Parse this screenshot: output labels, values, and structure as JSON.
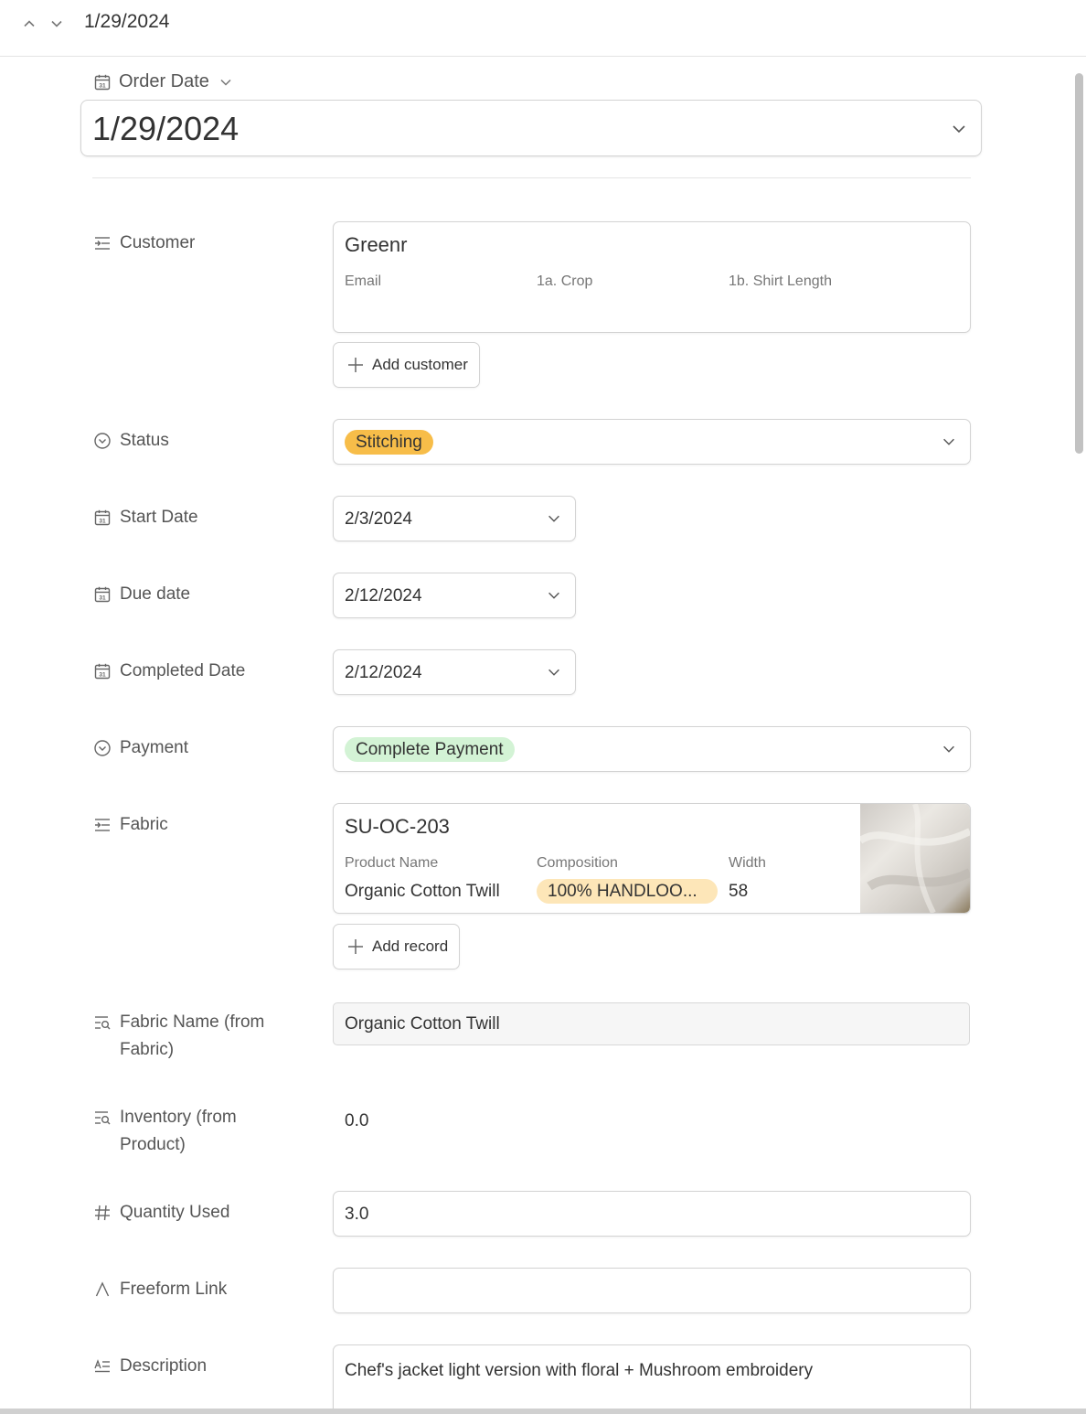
{
  "header": {
    "title": "1/29/2024",
    "prev_icon": "chevron-up-icon",
    "next_icon": "chevron-down-icon"
  },
  "primary_field": {
    "label": "Order Date",
    "value": "1/29/2024",
    "icon": "calendar-icon"
  },
  "customer": {
    "label": "Customer",
    "icon": "link-record-icon",
    "record": {
      "title": "Greenr",
      "columns": [
        "Email",
        "1a. Crop",
        "1b. Shirt Length"
      ]
    },
    "add_label": "Add customer"
  },
  "status": {
    "label": "Status",
    "icon": "single-select-icon",
    "value": "Stitching",
    "color": "#f7bd49"
  },
  "start_date": {
    "label": "Start Date",
    "icon": "calendar-icon",
    "value": "2/3/2024"
  },
  "due_date": {
    "label": "Due date",
    "icon": "calendar-icon",
    "value": "2/12/2024"
  },
  "completed_date": {
    "label": "Completed Date",
    "icon": "calendar-icon",
    "value": "2/12/2024"
  },
  "payment": {
    "label": "Payment",
    "icon": "single-select-icon",
    "value": "Complete Payment",
    "color": "#d3f3d5"
  },
  "fabric": {
    "label": "Fabric",
    "icon": "link-record-icon",
    "record": {
      "title": "SU-OC-203",
      "columns": [
        "Product Name",
        "Composition",
        "Width"
      ],
      "values": [
        "Organic Cotton Twill",
        "100% HANDLOO...",
        "58"
      ],
      "composition_color": "#fde6b8"
    },
    "add_label": "Add record"
  },
  "fabric_name": {
    "label": "Fabric Name (from Fabric)",
    "icon": "lookup-icon",
    "value": "Organic Cotton Twill"
  },
  "inventory": {
    "label": "Inventory (from Product)",
    "icon": "lookup-icon",
    "value": "0.0"
  },
  "quantity": {
    "label": "Quantity Used",
    "icon": "number-icon",
    "value": "3.0"
  },
  "freeform_link": {
    "label": "Freeform Link",
    "icon": "text-icon",
    "value": ""
  },
  "description": {
    "label": "Description",
    "icon": "long-text-icon",
    "value": "Chef's jacket light version with floral + Mushroom embroidery"
  }
}
